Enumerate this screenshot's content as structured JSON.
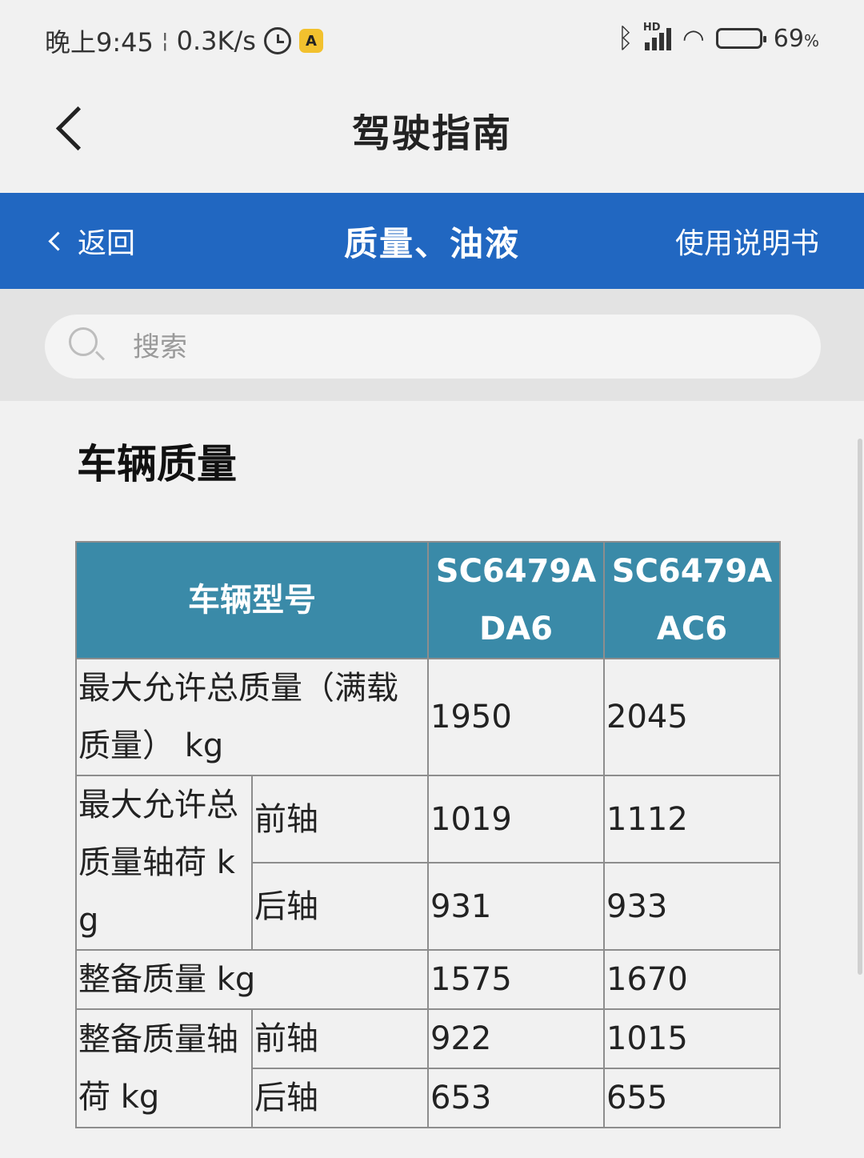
{
  "status_bar": {
    "time": "晚上9:45",
    "separator": "¦",
    "net_speed": "0.3K/s",
    "app_badge": "A",
    "hd": "HD",
    "battery_pct": "69",
    "battery_unit": "%",
    "battery_level": 0.69
  },
  "titlebar": {
    "title": "驾驶指南"
  },
  "nav": {
    "back_label": "返回",
    "section_title": "质量、油液",
    "manual_link": "使用说明书"
  },
  "search": {
    "placeholder": "搜索"
  },
  "content": {
    "heading": "车辆质量",
    "table": {
      "header_model": "车辆型号",
      "model_a": "SC6479ADA6",
      "model_b": "SC6479AAC6",
      "rows": {
        "max_total": {
          "label": "最大允许总质量（满载质量） kg",
          "a": "1950",
          "b": "2045"
        },
        "max_axle": {
          "label": "最大允许总质量轴荷 kg",
          "front_label": "前轴",
          "front_a": "1019",
          "front_b": "1112",
          "rear_label": "后轴",
          "rear_a": "931",
          "rear_b": "933"
        },
        "curb": {
          "label": "整备质量 kg",
          "a": "1575",
          "b": "1670"
        },
        "curb_axle": {
          "label": "整备质量轴荷 kg",
          "front_label": "前轴",
          "front_a": "922",
          "front_b": "1015",
          "rear_label": "后轴",
          "rear_a": "653",
          "rear_b": "655"
        }
      }
    }
  }
}
